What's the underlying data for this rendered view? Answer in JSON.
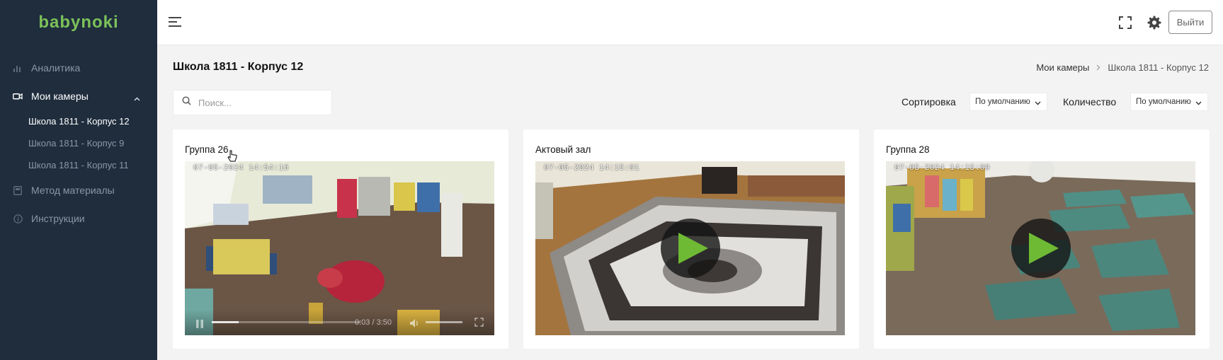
{
  "app": {
    "logo": "babynoki",
    "accent": "#7cc15a",
    "sidebar_bg": "#1f2d3d"
  },
  "sidebar": {
    "items": [
      {
        "label": "Аналитика",
        "icon": "bar-chart-icon"
      },
      {
        "label": "Мои камеры",
        "icon": "camera-icon",
        "expanded": true
      },
      {
        "label": "Метод материалы",
        "icon": "book-icon"
      },
      {
        "label": "Инструкции",
        "icon": "info-icon"
      }
    ],
    "cameras": [
      {
        "label": "Школа 1811 - Корпус 12",
        "active": true
      },
      {
        "label": "Школа 1811 - Корпус 9"
      },
      {
        "label": "Школа 1811 - Корпус 11"
      }
    ]
  },
  "header": {
    "logout_label": "Выйти"
  },
  "page": {
    "title": "Школа 1811 - Корпус 12",
    "breadcrumb": [
      "Мои камеры",
      "Школа 1811 - Корпус 12"
    ]
  },
  "controls": {
    "search_placeholder": "Поиск...",
    "sort_label": "Сортировка",
    "sort_value": "По умолчанию",
    "count_label": "Количество",
    "count_value": "По умолчанию"
  },
  "cameras": [
    {
      "title": "Группа 26",
      "timestamp": "07-05-2024 14:54:16",
      "playing": true,
      "time": "0:03 / 3:50",
      "progress": 0.18
    },
    {
      "title": "Актовый зал",
      "timestamp": "07-05-2024 14:15:01",
      "playing": false
    },
    {
      "title": "Группа 28",
      "timestamp": "07-05-2024 14:15:09",
      "playing": false
    }
  ]
}
